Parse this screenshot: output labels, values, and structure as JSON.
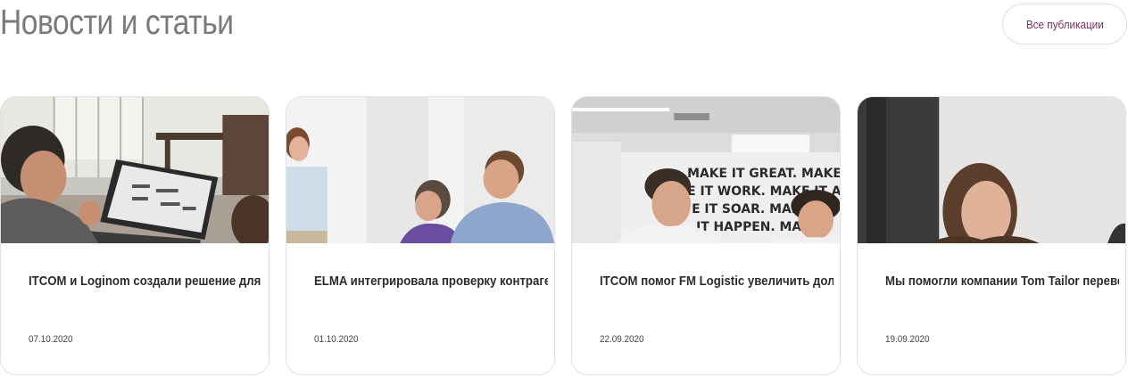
{
  "section": {
    "title": "Новости и статьи",
    "all_button_label": "Все публикации"
  },
  "cards": [
    {
      "heading": "ITCOM и Loginom создали решение для углубленного анализа и оценки",
      "date": "07.10.2020"
    },
    {
      "heading": "ELMA интегрировала проверку контрагентов ITCOM Consult.Фокус",
      "date": "01.10.2020"
    },
    {
      "heading": "ITCOM помог FM Logistic увеличить долю электронного",
      "date": "22.09.2020"
    },
    {
      "heading": "Мы помогли компании Tom Tailor перевести кассовые документы в",
      "date": "19.09.2020"
    }
  ],
  "photo_wall_text": [
    "MAKE IT GREAT. MAKE IT B",
    "E IT WORK. MAKE IT AWE",
    "E IT SOAR. MAKE IT",
    "IT HAPPEN. MAK"
  ]
}
